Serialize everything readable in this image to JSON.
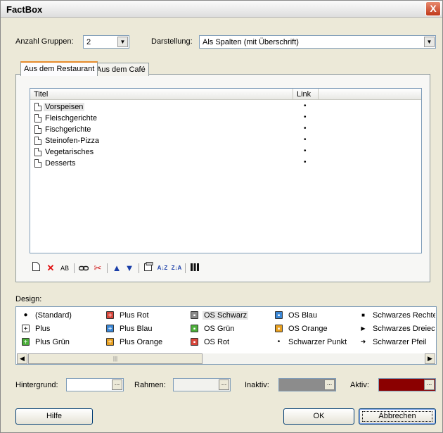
{
  "window": {
    "title": "FactBox",
    "close_glyph": "X"
  },
  "top": {
    "groups_label": "Anzahl Gruppen:",
    "groups_value": "2",
    "display_label": "Darstellung:",
    "display_value": "Als Spalten (mit Überschrift)"
  },
  "tabs": [
    {
      "label": "Aus dem Restaurant",
      "active": true
    },
    {
      "label": "Aus dem Café",
      "active": false
    }
  ],
  "list": {
    "columns": [
      "Titel",
      "Link"
    ],
    "rows": [
      {
        "title": "Vorspeisen",
        "link": "•",
        "selected": true
      },
      {
        "title": "Fleischgerichte",
        "link": "•"
      },
      {
        "title": "Fischgerichte",
        "link": "•"
      },
      {
        "title": "Steinofen-Pizza",
        "link": "•"
      },
      {
        "title": "Vegetarisches",
        "link": "•"
      },
      {
        "title": "Desserts",
        "link": "•"
      }
    ]
  },
  "toolbar": {
    "icons": [
      "new-item-icon",
      "delete-icon",
      "rename-icon",
      "link-icon",
      "unlink-icon",
      "move-up-icon",
      "move-down-icon",
      "properties-icon",
      "sort-ascending-icon",
      "sort-descending-icon",
      "columns-icon"
    ],
    "rename_text": "AB",
    "sort_asc_text": "A↓Z",
    "sort_desc_text": "Z↓A"
  },
  "design": {
    "label": "Design:",
    "items": [
      {
        "label": "(Standard)",
        "icon": "bullet-icon",
        "color": "#000000"
      },
      {
        "label": "Plus Rot",
        "icon": "plus-red-icon",
        "color": "#d9453a"
      },
      {
        "label": "OS Schwarz",
        "icon": "os-black-icon",
        "color": "#8a8a8a",
        "selected": true
      },
      {
        "label": "OS Blau",
        "icon": "os-blue-icon",
        "color": "#3a87d6"
      },
      {
        "label": "Schwarzes Rechte",
        "icon": "black-square-icon",
        "color": "#000000"
      },
      {
        "label": "Plus",
        "icon": "plus-icon",
        "color": "#000000"
      },
      {
        "label": "Plus Blau",
        "icon": "plus-blue-icon",
        "color": "#3a87d6"
      },
      {
        "label": "OS Grün",
        "icon": "os-green-icon",
        "color": "#4caf3a"
      },
      {
        "label": "OS Orange",
        "icon": "os-orange-icon",
        "color": "#e8a020"
      },
      {
        "label": "Schwarzes Dreieck",
        "icon": "black-triangle-icon",
        "color": "#000000"
      },
      {
        "label": "Plus Grün",
        "icon": "plus-green-icon",
        "color": "#4caf3a"
      },
      {
        "label": "Plus Orange",
        "icon": "plus-orange-icon",
        "color": "#e8a020"
      },
      {
        "label": "OS Rot",
        "icon": "os-red-icon",
        "color": "#d9453a"
      },
      {
        "label": "Schwarzer Punkt",
        "icon": "black-dot-icon",
        "color": "#000000"
      },
      {
        "label": "Schwarzer Pfeil",
        "icon": "black-arrow-icon",
        "color": "#000000"
      }
    ]
  },
  "colors": {
    "background_label": "Hintergrund:",
    "background_color": "#ffffff",
    "border_label": "Rahmen:",
    "border_color": "#f2f2ee",
    "inactive_label": "Inaktiv:",
    "inactive_color": "#8c8c8c",
    "active_label": "Aktiv:",
    "active_color": "#8b0000",
    "picker_glyph": "..."
  },
  "buttons": {
    "help": "Hilfe",
    "ok": "OK",
    "cancel": "Abbrechen"
  }
}
